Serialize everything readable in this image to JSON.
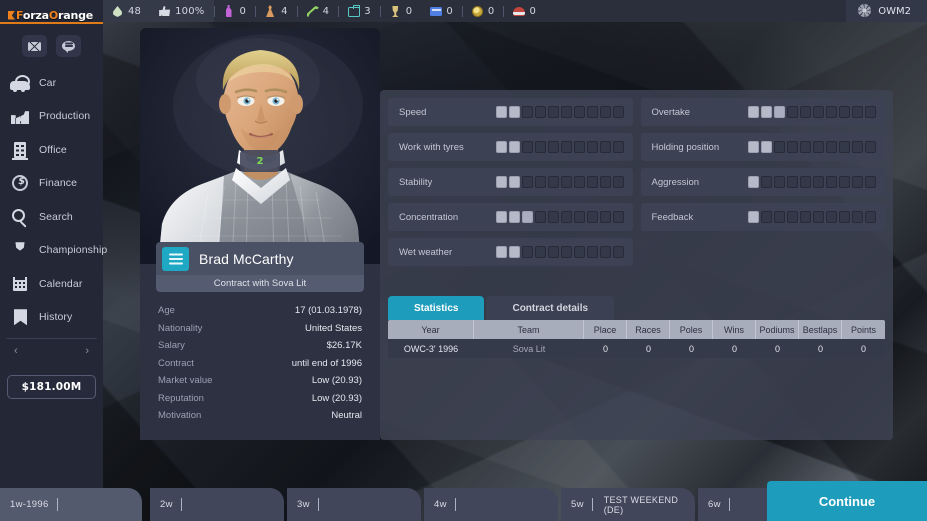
{
  "app": {
    "logo_prefix": "F",
    "logo_text_1": "orza",
    "logo_text_2": "O",
    "logo_text_3": "range"
  },
  "topbar": {
    "stats": [
      {
        "icon": "fuel-drop-icon",
        "value": "48"
      },
      {
        "icon": "thumbs-up-icon",
        "value": "100%"
      },
      {
        "icon": "bottle-icon",
        "value": "0"
      },
      {
        "icon": "person-icon",
        "value": "4"
      },
      {
        "icon": "wrench-icon",
        "value": "4"
      },
      {
        "icon": "briefcase-icon",
        "value": "3"
      },
      {
        "icon": "trophy-icon",
        "value": "0"
      },
      {
        "icon": "card-icon",
        "value": "0"
      },
      {
        "icon": "coin-icon",
        "value": "0"
      },
      {
        "icon": "helmet-icon",
        "value": "0"
      }
    ],
    "user": {
      "icon": "gear-icon",
      "name": "OWM2"
    }
  },
  "sidebar": {
    "messages": [
      {
        "icon": "envelope-icon",
        "name": "mail-button"
      },
      {
        "icon": "chat-bubble-icon",
        "name": "chat-button"
      }
    ],
    "items": [
      {
        "label": "Car",
        "icon": "car-icon"
      },
      {
        "label": "Production",
        "icon": "factory-icon"
      },
      {
        "label": "Office",
        "icon": "building-icon"
      },
      {
        "label": "Finance",
        "icon": "dollar-coin-icon"
      },
      {
        "label": "Search",
        "icon": "magnifier-icon"
      },
      {
        "label": "Championship",
        "icon": "trophy-icon"
      },
      {
        "label": "Calendar",
        "icon": "calendar-icon"
      },
      {
        "label": "History",
        "icon": "bookmark-icon"
      }
    ],
    "pager": {
      "prev": "‹",
      "next": "›"
    },
    "budget": "$181.00M"
  },
  "driver": {
    "number": "2",
    "name": "Brad McCarthy",
    "contract_line": "Contract with Sova Lit",
    "info": [
      {
        "key": "Age",
        "value": "17 (01.03.1978)"
      },
      {
        "key": "Nationality",
        "value": "United States"
      },
      {
        "key": "Salary",
        "value": "$26.17K"
      },
      {
        "key": "Contract",
        "value": "until end of 1996"
      },
      {
        "key": "Market value",
        "value": "Low (20.93)"
      },
      {
        "key": "Reputation",
        "value": "Low (20.93)"
      },
      {
        "key": "Motivation",
        "value": "Neutral"
      }
    ]
  },
  "attributes": {
    "max": 10,
    "left": [
      {
        "name": "Speed",
        "value": 2
      },
      {
        "name": "Work with tyres",
        "value": 2
      },
      {
        "name": "Stability",
        "value": 2
      },
      {
        "name": "Concentration",
        "value": 3
      },
      {
        "name": "Wet weather",
        "value": 2
      }
    ],
    "right": [
      {
        "name": "Overtake",
        "value": 3
      },
      {
        "name": "Holding position",
        "value": 2
      },
      {
        "name": "Aggression",
        "value": 1
      },
      {
        "name": "Feedback",
        "value": 1
      }
    ]
  },
  "tabs": [
    {
      "label": "Statistics",
      "active": true
    },
    {
      "label": "Contract details",
      "active": false
    }
  ],
  "table": {
    "columns": [
      "Year",
      "Team",
      "Place",
      "Races",
      "Poles",
      "Wins",
      "Podiums",
      "Bestlaps",
      "Points"
    ],
    "rows": [
      {
        "year": "OWC-3' 1996",
        "team": "Sova Lit",
        "place": "0",
        "races": "0",
        "poles": "0",
        "wins": "0",
        "podiums": "0",
        "bestlaps": "0",
        "points": "0"
      }
    ]
  },
  "timeline": {
    "segments": [
      {
        "label": "1w-1996",
        "event": ""
      },
      {
        "label": "2w",
        "event": ""
      },
      {
        "label": "3w",
        "event": ""
      },
      {
        "label": "4w",
        "event": ""
      },
      {
        "label": "5w",
        "event": "TEST WEEKEND (DE)"
      },
      {
        "label": "6w",
        "event": ""
      }
    ],
    "continue": "Continue"
  },
  "colors": {
    "accent": "#1e9cbb",
    "brand_orange": "#e07b18",
    "badge_green": "#7ed957"
  }
}
